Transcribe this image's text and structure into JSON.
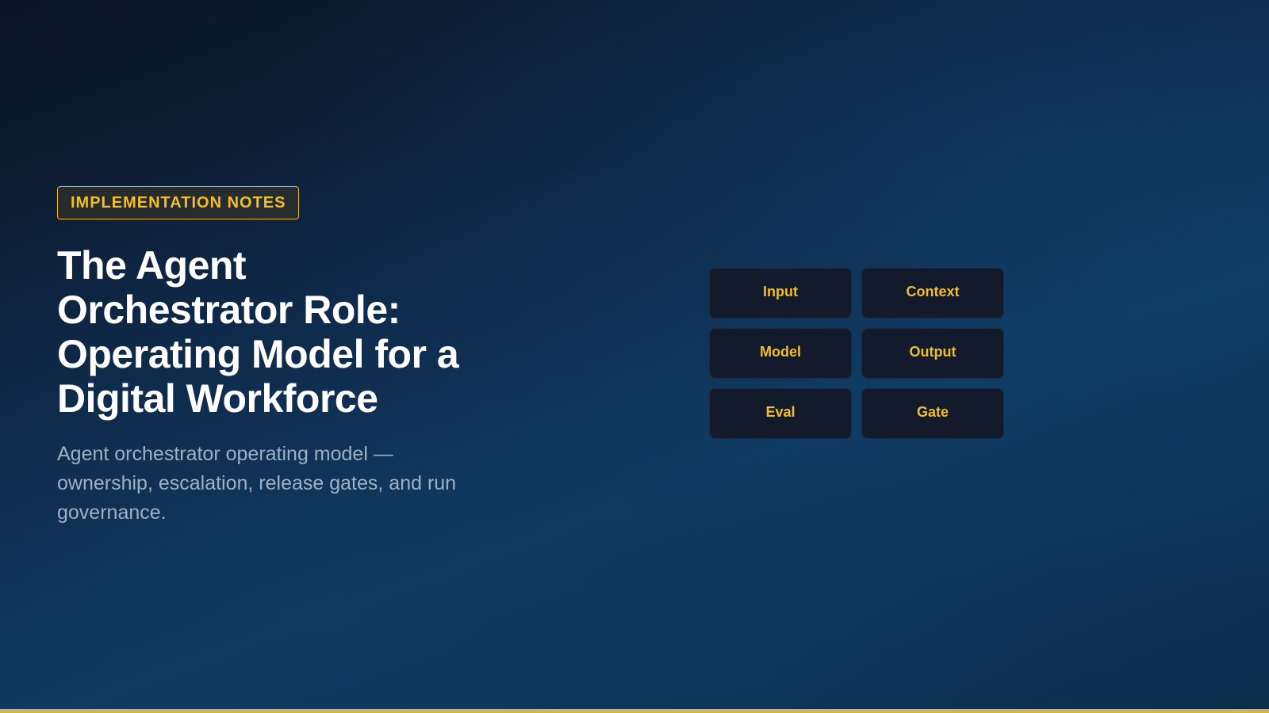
{
  "badge": {
    "label": "IMPLEMENTATION NOTES"
  },
  "title": "The Agent Orchestrator Role: Operating Model for a Digital Workforce",
  "subtitle": "Agent orchestrator operating model — ownership, escalation, release gates, and run governance.",
  "tiles": [
    {
      "label": "Input"
    },
    {
      "label": "Context"
    },
    {
      "label": "Model"
    },
    {
      "label": "Output"
    },
    {
      "label": "Eval"
    },
    {
      "label": "Gate"
    }
  ],
  "colors": {
    "accent": "#f3bd2c",
    "bottom_bar": "#d6b349",
    "tile_bg": "#131a2c",
    "title": "#ffffff",
    "subtitle": "#9fb0c2"
  }
}
